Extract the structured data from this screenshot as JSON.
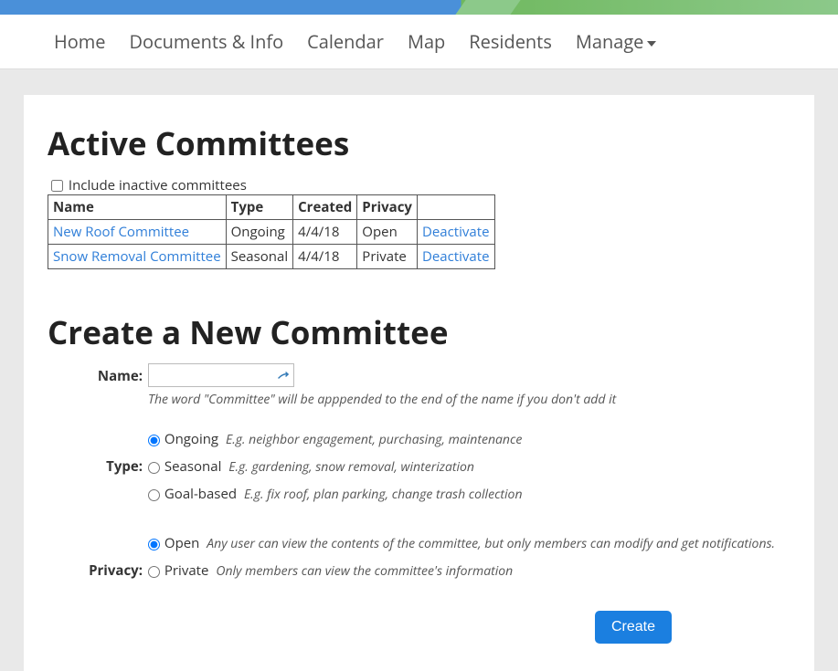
{
  "nav": {
    "home": "Home",
    "docs": "Documents & Info",
    "calendar": "Calendar",
    "map": "Map",
    "residents": "Residents",
    "manage": "Manage"
  },
  "headings": {
    "active": "Active Committees",
    "create": "Create a New Committee"
  },
  "include_inactive_label": "Include inactive committees",
  "table": {
    "headers": {
      "name": "Name",
      "type": "Type",
      "created": "Created",
      "privacy": "Privacy",
      "action": ""
    },
    "rows": [
      {
        "name": "New Roof Committee",
        "type": "Ongoing",
        "created": "4/4/18",
        "privacy": "Open",
        "action": "Deactivate"
      },
      {
        "name": "Snow Removal Committee",
        "type": "Seasonal",
        "created": "4/4/18",
        "privacy": "Private",
        "action": "Deactivate"
      }
    ]
  },
  "form": {
    "name_label": "Name:",
    "name_hint": "The word \"Committee\" will be apppended to the end of the name if you don't add it",
    "type_label": "Type:",
    "type_options": {
      "ongoing": {
        "label": "Ongoing",
        "desc": "E.g. neighbor engagement, purchasing, maintenance"
      },
      "seasonal": {
        "label": "Seasonal",
        "desc": "E.g. gardening, snow removal, winterization"
      },
      "goal": {
        "label": "Goal-based",
        "desc": "E.g. fix roof, plan parking, change trash collection"
      }
    },
    "privacy_label": "Privacy:",
    "privacy_options": {
      "open": {
        "label": "Open",
        "desc": "Any user can view the contents of the committee, but only members can modify and get notifications."
      },
      "private": {
        "label": "Private",
        "desc": "Only members can view the committee's information"
      }
    },
    "create_button": "Create"
  }
}
